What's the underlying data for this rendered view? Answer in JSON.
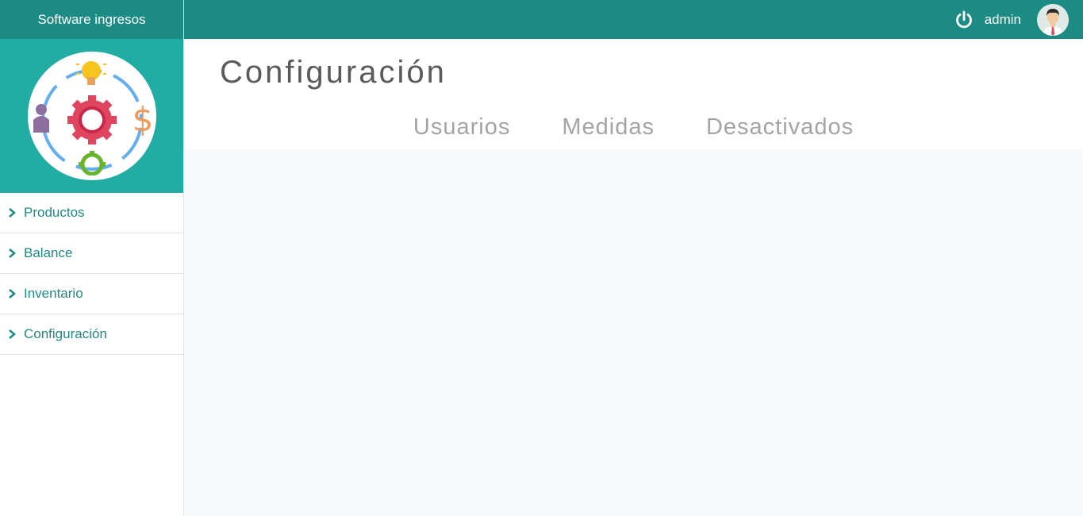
{
  "app": {
    "title": "Software ingresos"
  },
  "sidebar": {
    "items": [
      {
        "label": "Productos"
      },
      {
        "label": "Balance"
      },
      {
        "label": "Inventario"
      },
      {
        "label": "Configuración"
      }
    ]
  },
  "topbar": {
    "username": "admin",
    "icons": [
      "power-icon",
      "user-avatar"
    ]
  },
  "page": {
    "title": "Configuración"
  },
  "tabs": [
    {
      "label": "Usuarios"
    },
    {
      "label": "Medidas"
    },
    {
      "label": "Desactivados"
    }
  ],
  "colors": {
    "primary_dark": "#1c8b83",
    "primary": "#21aca4",
    "link": "#1e8a82",
    "title_text": "#5a5a5a",
    "tab_text": "#a4a4a4",
    "content_bg": "#f8f9fb"
  }
}
